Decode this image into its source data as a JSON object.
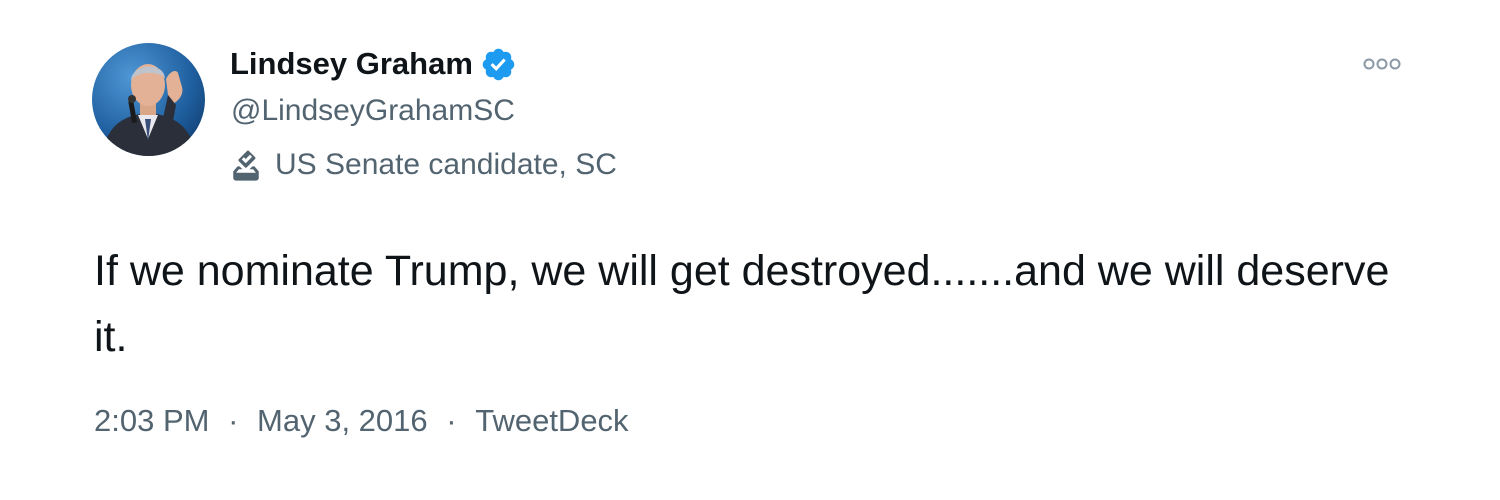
{
  "tweet": {
    "author": {
      "display_name": "Lindsey Graham",
      "handle": "@LindseyGrahamSC",
      "verified_icon": "verified-badge-icon",
      "label_icon": "ballot-box-icon",
      "label": "US Senate candidate, SC"
    },
    "text": "If we nominate Trump, we will get destroyed.......and we will deserve it.",
    "time": "2:03 PM",
    "separator": "·",
    "date": "May 3, 2016",
    "source": "TweetDeck",
    "more_icon": "more-options-icon"
  },
  "colors": {
    "verified_blue": "#1d9bf0",
    "text_primary": "#0f1419",
    "text_secondary": "#536471"
  }
}
